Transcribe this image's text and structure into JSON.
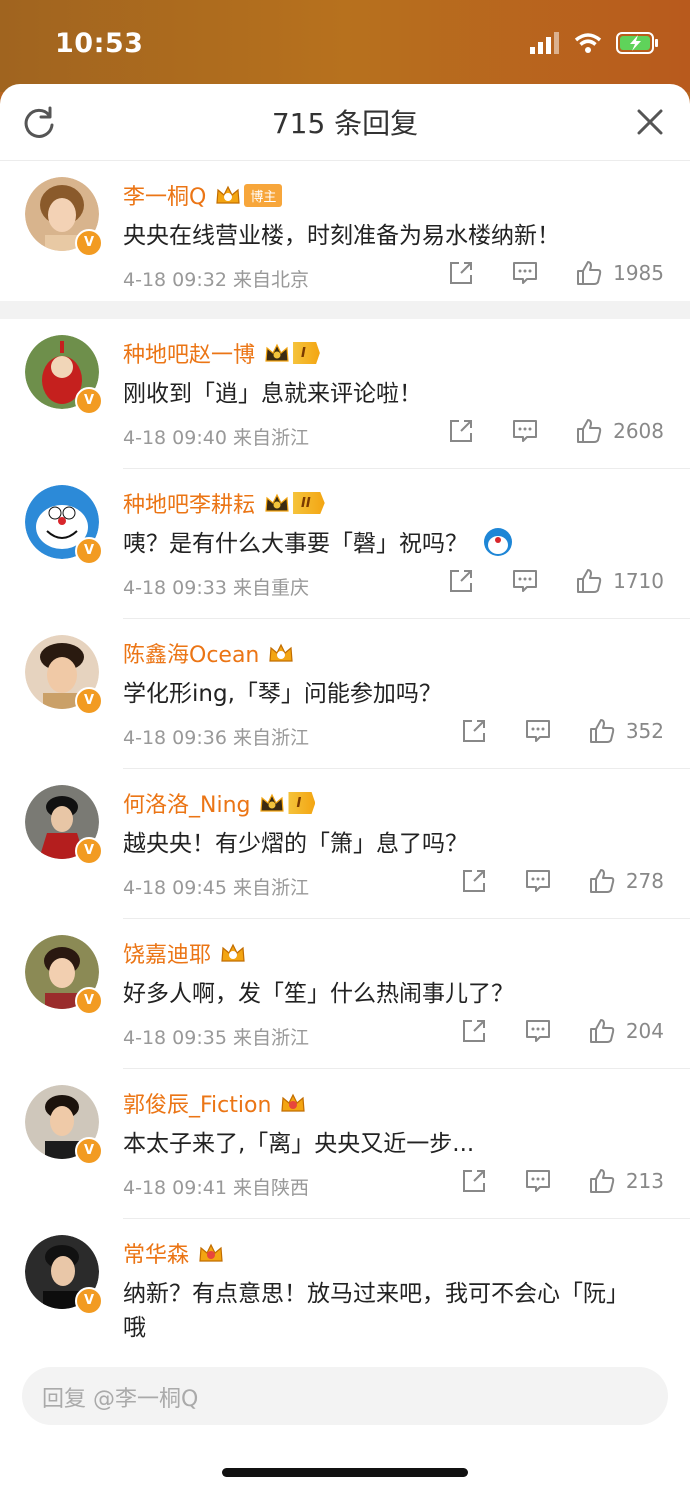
{
  "status_bar": {
    "time": "10:53"
  },
  "header": {
    "title": "715 条回复"
  },
  "comments": [
    {
      "name": "李一桐Q",
      "badge": "博主",
      "text": "央央在线营业楼，时刻准备为易水楼纳新！",
      "time": "4-18 09:32",
      "location": "来自北京",
      "likes": "1985"
    },
    {
      "name": "种地吧赵一博",
      "level": "I",
      "text": "刚收到「逍」息就来评论啦！",
      "time": "4-18 09:40",
      "location": "来自浙江",
      "likes": "2608"
    },
    {
      "name": "种地吧李耕耘",
      "level": "II",
      "text": "咦？是有什么大事要「磬」祝吗？",
      "time": "4-18 09:33",
      "location": "来自重庆",
      "likes": "1710"
    },
    {
      "name": "陈鑫海Ocean",
      "text": "学化形ing,「琴」问能参加吗？",
      "time": "4-18 09:36",
      "location": "来自浙江",
      "likes": "352"
    },
    {
      "name": "何洛洛_Ning",
      "level": "I",
      "text": "越央央！有少熠的「箫」息了吗？",
      "time": "4-18 09:45",
      "location": "来自浙江",
      "likes": "278"
    },
    {
      "name": "饶嘉迪耶",
      "text": "好多人啊，发「笙」什么热闹事儿了？",
      "time": "4-18 09:35",
      "location": "来自浙江",
      "likes": "204"
    },
    {
      "name": "郭俊辰_Fiction",
      "text": "本太子来了,「离」央央又近一步...",
      "time": "4-18 09:41",
      "location": "来自陕西",
      "likes": "213"
    },
    {
      "name": "常华森",
      "text": "纳新？有点意思！放马过来吧，我可不会心「阮」哦"
    }
  ],
  "reply_input": {
    "placeholder": "回复 @李一桐Q"
  },
  "colors": {
    "accent": "#eb7515",
    "verified": "#f29b22"
  }
}
